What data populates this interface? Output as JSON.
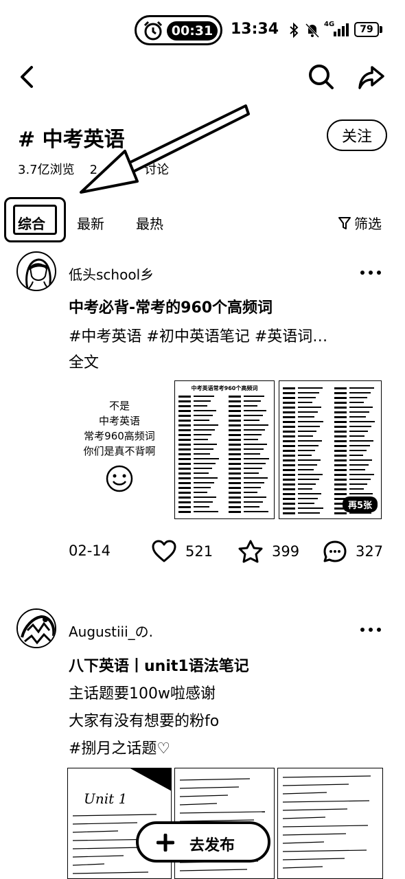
{
  "status_bar": {
    "recording_time": "00:31",
    "clock": "13:34",
    "network": "4G",
    "battery": "79"
  },
  "topic": {
    "title": "# 中考英语",
    "follow_label": "关注",
    "views": "3.7亿浏览",
    "discussions": "2",
    "discussions_suffix": "讨论"
  },
  "tabs": {
    "items": [
      "综合",
      "最新",
      "最热"
    ],
    "selected": "综合",
    "filter_label": "筛选"
  },
  "posts": [
    {
      "author": "低头school乡",
      "title": "中考必背-常考的960个高频词",
      "lines": [
        "#中考英语  #初中英语笔记  #英语词…",
        "全文"
      ],
      "cover_text": [
        "不是",
        "中考英语",
        "常考960高频词",
        "你们是真不背啊"
      ],
      "doc_heading": "中考英语常考960个高频词",
      "image_badge": "再5张",
      "date": "02-14",
      "likes": "521",
      "favorites": "399",
      "comments": "327"
    },
    {
      "author": "Augustiii_の.",
      "title": "八下英语丨unit1语法笔记",
      "lines": [
        "主话题要100w啦感谢",
        "大家有没有想要的粉fo",
        "#捌月之话题♡"
      ],
      "note_heading": "Unit 1"
    }
  ],
  "publish": {
    "label": "去发布"
  }
}
